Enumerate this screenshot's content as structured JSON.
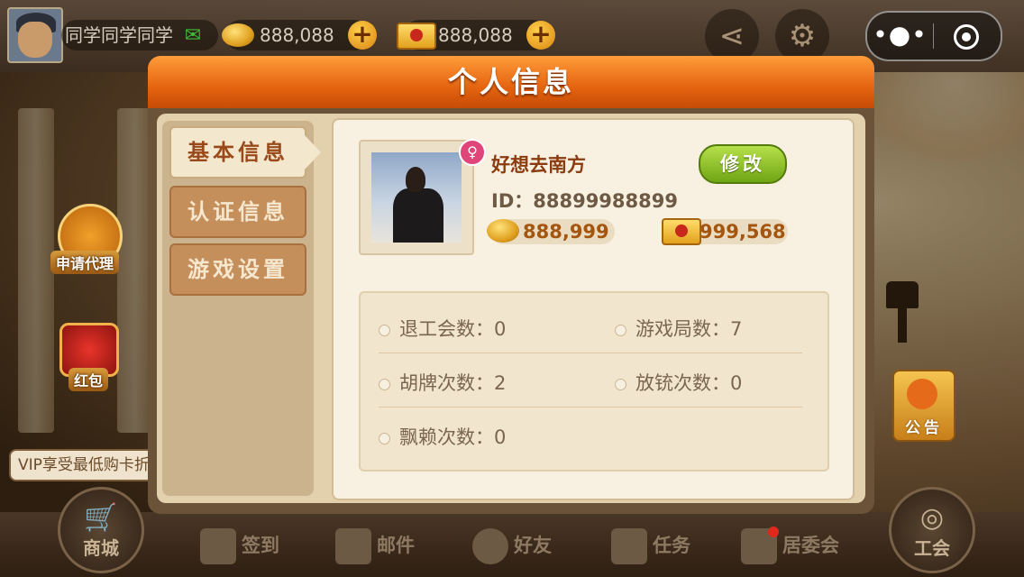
{
  "topbar": {
    "nickname": "同学同学同学",
    "gold": "888,088",
    "card": "888,088"
  },
  "side": {
    "agent_label": "申请代理",
    "redpacket_label": "红包",
    "vip_tip": "VIP享受最低购卡折",
    "notice_label": "公告"
  },
  "bottom_nav": {
    "shop": "商城",
    "signin": "签到",
    "mail": "邮件",
    "friends": "好友",
    "tasks": "任务",
    "committee": "居委会",
    "union": "工会"
  },
  "dialog": {
    "title": "个人信息",
    "tabs": [
      "基本信息",
      "认证信息",
      "游戏设置"
    ],
    "profile": {
      "nickname": "好想去南方",
      "edit_label": "修改",
      "id_text": "ID：88899988899",
      "gold": "888,999",
      "card": "999,568"
    },
    "stats": [
      {
        "label": "退工会数：0"
      },
      {
        "label": "游戏局数：7"
      },
      {
        "label": "胡牌次数：2"
      },
      {
        "label": "放铳次数：0"
      },
      {
        "label": "飘赖次数：0"
      }
    ]
  },
  "colors": {
    "title_orange": "#e56410",
    "edit_green": "#6fa514",
    "text_brown": "#8a3c10"
  }
}
